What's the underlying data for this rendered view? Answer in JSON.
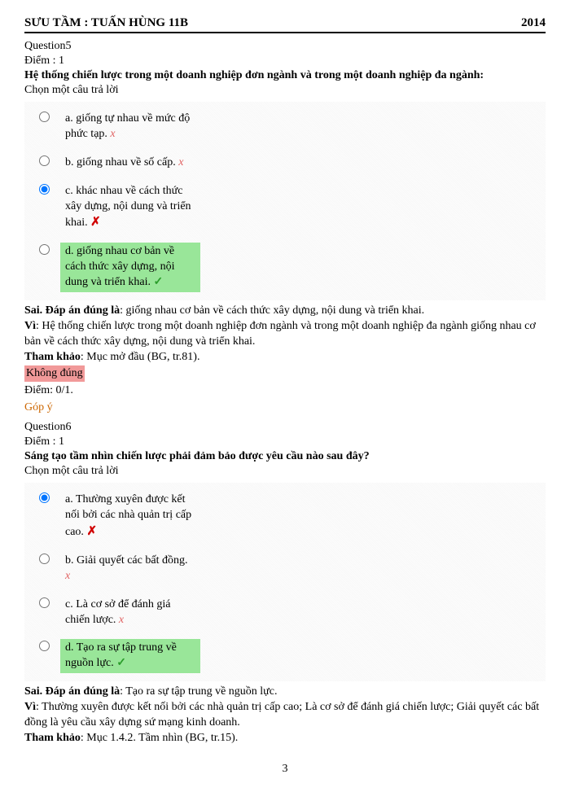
{
  "header": {
    "left": "SƯU TẦM : TUẤN HÙNG 11B",
    "right": "2014"
  },
  "q5": {
    "title": "Question5",
    "points": "Điểm : 1",
    "text": "Hệ thống chiến lược trong một doanh nghiệp đơn ngành và trong một doanh nghiệp đa ngành:",
    "choose": "Chọn một câu trả lời",
    "options": [
      {
        "text": "a. giống tự nhau về mức độ phức tạp.",
        "mark": "wrong-small",
        "selected": false,
        "correct": false
      },
      {
        "text": "b. giống nhau về số cấp.",
        "mark": "wrong-small",
        "selected": false,
        "correct": false
      },
      {
        "text": "c. khác nhau về cách thức xây dựng, nội dung và triển khai.",
        "mark": "wrong-big",
        "selected": true,
        "correct": false
      },
      {
        "text": "d. giống nhau cơ bản về cách thức xây dựng, nội dung và triển khai.",
        "mark": "correct",
        "selected": false,
        "correct": true
      }
    ],
    "feedback": {
      "sai_label": "Sai. Đáp án đúng là",
      "sai_text": ": giống nhau cơ bản về cách thức xây dựng, nội dung và triển khai.",
      "vi_label": "Vì",
      "vi_text": ": Hệ thống chiến lược trong một doanh nghiệp đơn ngành và trong một doanh nghiệp đa ngành giống nhau cơ bản về cách thức xây dựng, nội dung và triển khai.",
      "ref_label": "Tham khảo",
      "ref_text": ": Mục mở đầu (BG, tr.81).",
      "incorrect": "Không đúng",
      "score": "Điểm: 0/1.",
      "hint": "Góp ý"
    }
  },
  "q6": {
    "title": "Question6",
    "points": "Điểm : 1",
    "text": "Sáng tạo tầm nhìn chiến lược phải đảm bảo được yêu cầu nào sau đây?",
    "choose": "Chọn một câu trả lời",
    "options": [
      {
        "text": "a. Thường xuyên được kết nối bởi các nhà quản trị cấp cao.",
        "mark": "wrong-big",
        "selected": true,
        "correct": false
      },
      {
        "text": "b. Giải quyết các bất đồng.",
        "mark": "wrong-small",
        "selected": false,
        "correct": false
      },
      {
        "text": "c. Là cơ sở để đánh giá chiến lược.",
        "mark": "wrong-small",
        "selected": false,
        "correct": false
      },
      {
        "text": "d. Tạo ra sự tập trung về nguồn lực.",
        "mark": "correct",
        "selected": false,
        "correct": true
      }
    ],
    "feedback": {
      "sai_label": "Sai. Đáp án đúng là",
      "sai_text": ": Tạo ra sự tập trung về nguồn lực.",
      "vi_label": "Vì",
      "vi_text": ": Thường xuyên được kết nối bởi các nhà quản trị cấp cao; Là cơ sở để đánh giá chiến lược; Giải quyết các bất đồng là yêu cầu xây dựng sứ mạng kinh doanh.",
      "ref_label": "Tham khảo",
      "ref_text": ": Mục 1.4.2. Tầm nhìn (BG, tr.15)."
    }
  },
  "page_number": "3"
}
